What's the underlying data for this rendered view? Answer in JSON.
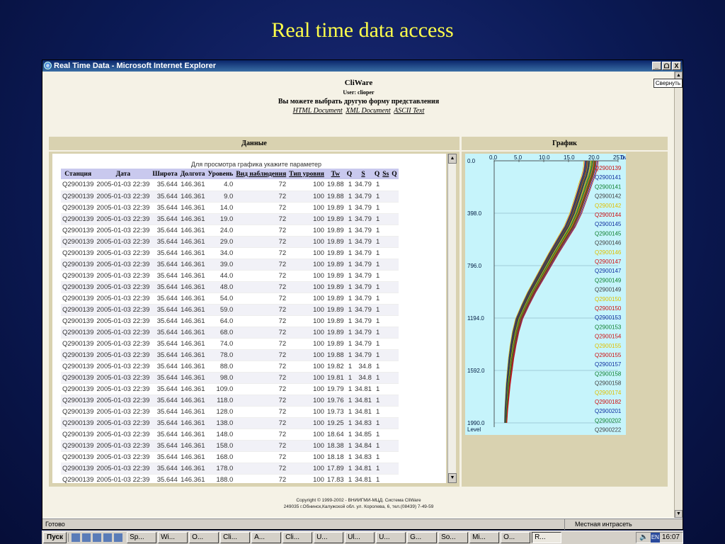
{
  "slide_title": "Real time data access",
  "window": {
    "title": "Real Time Data - Microsoft Internet Explorer",
    "buttons": {
      "minimize": "_",
      "restore": "ᗝ",
      "close": "X"
    }
  },
  "svernut_label": "Свернуть",
  "header": {
    "app": "CliWare",
    "user": "User: clioper",
    "choose": "Вы можете выбрать другую форму представления",
    "links": [
      "HTML Document",
      "XML Document",
      "ASCII Text"
    ]
  },
  "sections": {
    "data": "Данные",
    "graph": "График"
  },
  "hint": "Для просмотра графика укажите параметер",
  "table": {
    "headers": [
      "Станция",
      "Дата",
      "Широта",
      "Долгота",
      "Уровень",
      "Вид наблюдения",
      "Тип уровня",
      "Tw",
      "Q",
      "S",
      "Q",
      "Ss",
      "Q"
    ],
    "rows": [
      [
        "Q2900139",
        "2005-01-03 22:39",
        "35.644",
        "146.361",
        "4.0",
        "72",
        "100",
        "19.88",
        "1",
        "34.79",
        "1"
      ],
      [
        "Q2900139",
        "2005-01-03 22:39",
        "35.644",
        "146.361",
        "9.0",
        "72",
        "100",
        "19.88",
        "1",
        "34.79",
        "1"
      ],
      [
        "Q2900139",
        "2005-01-03 22:39",
        "35.644",
        "146.361",
        "14.0",
        "72",
        "100",
        "19.89",
        "1",
        "34.79",
        "1"
      ],
      [
        "Q2900139",
        "2005-01-03 22:39",
        "35.644",
        "146.361",
        "19.0",
        "72",
        "100",
        "19.89",
        "1",
        "34.79",
        "1"
      ],
      [
        "Q2900139",
        "2005-01-03 22:39",
        "35.644",
        "146.361",
        "24.0",
        "72",
        "100",
        "19.89",
        "1",
        "34.79",
        "1"
      ],
      [
        "Q2900139",
        "2005-01-03 22:39",
        "35.644",
        "146.361",
        "29.0",
        "72",
        "100",
        "19.89",
        "1",
        "34.79",
        "1"
      ],
      [
        "Q2900139",
        "2005-01-03 22:39",
        "35.644",
        "146.361",
        "34.0",
        "72",
        "100",
        "19.89",
        "1",
        "34.79",
        "1"
      ],
      [
        "Q2900139",
        "2005-01-03 22:39",
        "35.644",
        "146.361",
        "39.0",
        "72",
        "100",
        "19.89",
        "1",
        "34.79",
        "1"
      ],
      [
        "Q2900139",
        "2005-01-03 22:39",
        "35.644",
        "146.361",
        "44.0",
        "72",
        "100",
        "19.89",
        "1",
        "34.79",
        "1"
      ],
      [
        "Q2900139",
        "2005-01-03 22:39",
        "35.644",
        "146.361",
        "48.0",
        "72",
        "100",
        "19.89",
        "1",
        "34.79",
        "1"
      ],
      [
        "Q2900139",
        "2005-01-03 22:39",
        "35.644",
        "146.361",
        "54.0",
        "72",
        "100",
        "19.89",
        "1",
        "34.79",
        "1"
      ],
      [
        "Q2900139",
        "2005-01-03 22:39",
        "35.644",
        "146.361",
        "59.0",
        "72",
        "100",
        "19.89",
        "1",
        "34.79",
        "1"
      ],
      [
        "Q2900139",
        "2005-01-03 22:39",
        "35.644",
        "146.361",
        "64.0",
        "72",
        "100",
        "19.89",
        "1",
        "34.79",
        "1"
      ],
      [
        "Q2900139",
        "2005-01-03 22:39",
        "35.644",
        "146.361",
        "68.0",
        "72",
        "100",
        "19.89",
        "1",
        "34.79",
        "1"
      ],
      [
        "Q2900139",
        "2005-01-03 22:39",
        "35.644",
        "146.361",
        "74.0",
        "72",
        "100",
        "19.89",
        "1",
        "34.79",
        "1"
      ],
      [
        "Q2900139",
        "2005-01-03 22:39",
        "35.644",
        "146.361",
        "78.0",
        "72",
        "100",
        "19.88",
        "1",
        "34.79",
        "1"
      ],
      [
        "Q2900139",
        "2005-01-03 22:39",
        "35.644",
        "146.361",
        "88.0",
        "72",
        "100",
        "19.82",
        "1",
        "34.8",
        "1"
      ],
      [
        "Q2900139",
        "2005-01-03 22:39",
        "35.644",
        "146.361",
        "98.0",
        "72",
        "100",
        "19.81",
        "1",
        "34.8",
        "1"
      ],
      [
        "Q2900139",
        "2005-01-03 22:39",
        "35.644",
        "146.361",
        "109.0",
        "72",
        "100",
        "19.79",
        "1",
        "34.81",
        "1"
      ],
      [
        "Q2900139",
        "2005-01-03 22:39",
        "35.644",
        "146.361",
        "118.0",
        "72",
        "100",
        "19.76",
        "1",
        "34.81",
        "1"
      ],
      [
        "Q2900139",
        "2005-01-03 22:39",
        "35.644",
        "146.361",
        "128.0",
        "72",
        "100",
        "19.73",
        "1",
        "34.81",
        "1"
      ],
      [
        "Q2900139",
        "2005-01-03 22:39",
        "35.644",
        "146.361",
        "138.0",
        "72",
        "100",
        "19.25",
        "1",
        "34.83",
        "1"
      ],
      [
        "Q2900139",
        "2005-01-03 22:39",
        "35.644",
        "146.361",
        "148.0",
        "72",
        "100",
        "18.64",
        "1",
        "34.85",
        "1"
      ],
      [
        "Q2900139",
        "2005-01-03 22:39",
        "35.644",
        "146.361",
        "158.0",
        "72",
        "100",
        "18.38",
        "1",
        "34.84",
        "1"
      ],
      [
        "Q2900139",
        "2005-01-03 22:39",
        "35.644",
        "146.361",
        "168.0",
        "72",
        "100",
        "18.18",
        "1",
        "34.83",
        "1"
      ],
      [
        "Q2900139",
        "2005-01-03 22:39",
        "35.644",
        "146.361",
        "178.0",
        "72",
        "100",
        "17.89",
        "1",
        "34.81",
        "1"
      ],
      [
        "Q2900139",
        "2005-01-03 22:39",
        "35.644",
        "146.361",
        "188.0",
        "72",
        "100",
        "17.83",
        "1",
        "34.81",
        "1"
      ]
    ]
  },
  "chart_data": {
    "type": "line",
    "x_ticks": [
      "0.0",
      "5.0",
      "10.0",
      "15.0",
      "20.0",
      "25.0"
    ],
    "x_label": "Tw",
    "y_ticks": [
      "0.0",
      "398.0",
      "796.0",
      "1194.0",
      "1592.0",
      "1990.0"
    ],
    "y_label": "Level",
    "xlim": [
      0,
      25
    ],
    "ylim": [
      0,
      1990
    ],
    "y_inverted": true,
    "series": [
      {
        "name": "Q2900139",
        "color": "#d01010",
        "shift": 0.0
      },
      {
        "name": "Q2900141",
        "color": "#1030a0",
        "shift": 0.4
      },
      {
        "name": "Q2900141",
        "color": "#108030",
        "shift": -0.3
      },
      {
        "name": "Q2900142",
        "color": "#404040",
        "shift": 0.6
      },
      {
        "name": "Q2900142",
        "color": "#e0c000",
        "shift": -0.6
      },
      {
        "name": "Q2900144",
        "color": "#d01010",
        "shift": 1.0
      },
      {
        "name": "Q2900145",
        "color": "#1030a0",
        "shift": -0.9
      },
      {
        "name": "Q2900145",
        "color": "#108030",
        "shift": 0.8
      },
      {
        "name": "Q2900146",
        "color": "#404040",
        "shift": -0.2
      },
      {
        "name": "Q2900146",
        "color": "#e0c000",
        "shift": 0.2
      },
      {
        "name": "Q2900147",
        "color": "#d01010",
        "shift": -1.2
      },
      {
        "name": "Q2900147",
        "color": "#1030a0",
        "shift": 1.3
      },
      {
        "name": "Q2900149",
        "color": "#108030",
        "shift": 0.1
      },
      {
        "name": "Q2900149",
        "color": "#404040",
        "shift": -0.5
      },
      {
        "name": "Q2900150",
        "color": "#e0c000",
        "shift": 0.5
      },
      {
        "name": "Q2900150",
        "color": "#d01010",
        "shift": -0.8
      },
      {
        "name": "Q2900153",
        "color": "#1030a0",
        "shift": 0.3
      },
      {
        "name": "Q2900153",
        "color": "#108030",
        "shift": -1.0
      },
      {
        "name": "Q2900154",
        "color": "#d01010",
        "shift": 1.5
      },
      {
        "name": "Q2900155",
        "color": "#e0c000",
        "shift": -1.4
      },
      {
        "name": "Q2900155",
        "color": "#d01010",
        "shift": 0.7
      },
      {
        "name": "Q2900157",
        "color": "#1030a0",
        "shift": -0.4
      },
      {
        "name": "Q2900158",
        "color": "#108030",
        "shift": 0.9
      },
      {
        "name": "Q2900158",
        "color": "#404040",
        "shift": -0.7
      },
      {
        "name": "Q2900174",
        "color": "#e0c000",
        "shift": 0.0
      },
      {
        "name": "Q2900182",
        "color": "#d01010",
        "shift": 1.1
      },
      {
        "name": "Q2900201",
        "color": "#1030a0",
        "shift": -1.1
      },
      {
        "name": "Q2900202",
        "color": "#108030",
        "shift": 0.35
      },
      {
        "name": "Q2900222",
        "color": "#404040",
        "shift": -0.35
      }
    ],
    "base_profile": {
      "levels": [
        0,
        40,
        80,
        120,
        160,
        220,
        300,
        400,
        500,
        600,
        700,
        800,
        900,
        1000,
        1100,
        1200,
        1300,
        1400,
        1500,
        1600,
        1700,
        1800,
        1900,
        1990
      ],
      "tw": [
        19.5,
        19.4,
        19.2,
        18.9,
        18.5,
        18.0,
        17.3,
        16.4,
        15.2,
        13.6,
        12.0,
        10.5,
        9.0,
        7.5,
        6.2,
        5.0,
        4.3,
        3.8,
        3.4,
        3.1,
        2.8,
        2.6,
        2.4,
        2.3
      ]
    }
  },
  "copyright": [
    "Copyright © 1999-2002 - ВНИИГМИ-МЦД. Система CliWare",
    "249035 г.Обнинск,Калужской обл. ул. Королева, 6, тел.(08439) 7-49-59"
  ],
  "status": {
    "left": "Готово",
    "right": "Местная интрасеть"
  },
  "taskbar": {
    "start": "Пуск",
    "tasks": [
      "Sp...",
      "Wi...",
      "O...",
      "Cli...",
      "A...",
      "Cli...",
      "U...",
      "Ul...",
      "U...",
      "G...",
      "So...",
      "Mi...",
      "O...",
      "R..."
    ],
    "lang": "EN",
    "clock": "16:07"
  }
}
